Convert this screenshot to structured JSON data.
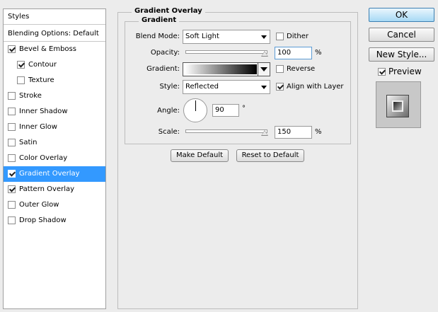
{
  "styles_panel": {
    "header": "Styles",
    "blending_options": "Blending Options: Default",
    "items": [
      {
        "label": "Bevel & Emboss",
        "checked": true
      },
      {
        "label": "Contour",
        "checked": true
      },
      {
        "label": "Texture",
        "checked": false
      },
      {
        "label": "Stroke",
        "checked": false
      },
      {
        "label": "Inner Shadow",
        "checked": false
      },
      {
        "label": "Inner Glow",
        "checked": false
      },
      {
        "label": "Satin",
        "checked": false
      },
      {
        "label": "Color Overlay",
        "checked": false
      },
      {
        "label": "Gradient Overlay",
        "checked": true,
        "selected": true
      },
      {
        "label": "Pattern Overlay",
        "checked": true
      },
      {
        "label": "Outer Glow",
        "checked": false
      },
      {
        "label": "Drop Shadow",
        "checked": false
      }
    ]
  },
  "gradient_overlay": {
    "title": "Gradient Overlay",
    "subtitle": "Gradient",
    "blend_mode_label": "Blend Mode:",
    "blend_mode_value": "Soft Light",
    "dither_label": "Dither",
    "dither_checked": false,
    "opacity_label": "Opacity:",
    "opacity_value": "100",
    "opacity_unit": "%",
    "gradient_label": "Gradient:",
    "reverse_label": "Reverse",
    "reverse_checked": false,
    "style_label": "Style:",
    "style_value": "Reflected",
    "align_label": "Align with Layer",
    "align_checked": true,
    "angle_label": "Angle:",
    "angle_value": "90",
    "angle_unit": "°",
    "scale_label": "Scale:",
    "scale_value": "150",
    "scale_unit": "%",
    "make_default": "Make Default",
    "reset_default": "Reset to Default"
  },
  "dialog_buttons": {
    "ok": "OK",
    "cancel": "Cancel",
    "new_style": "New Style...",
    "preview_label": "Preview",
    "preview_checked": true
  },
  "colors": {
    "selection": "#3399ff",
    "ok_accent": "#a7d9f5"
  }
}
